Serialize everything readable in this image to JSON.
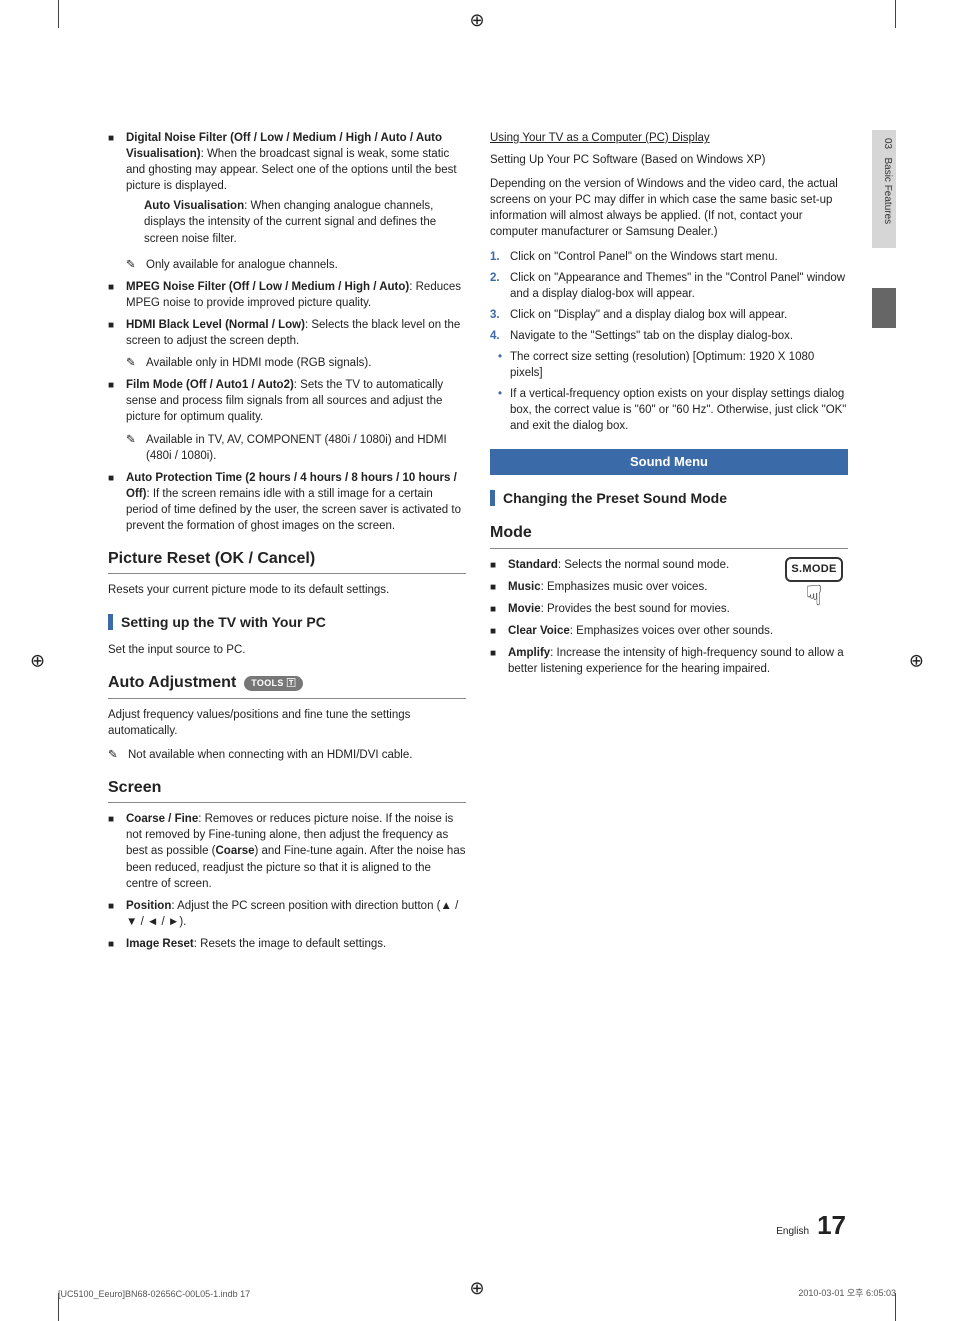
{
  "marks": {
    "reg": "⊕"
  },
  "sideTab": {
    "chapter": "03",
    "title": "Basic Features"
  },
  "left": {
    "items1": [
      {
        "head": "Digital Noise Filter (Off / Low / Medium / High / Auto / Auto Visualisation)",
        "body": ": When the broadcast signal is weak, some static and ghosting may appear. Select one of the options until the best picture is displayed.",
        "sub": [
          {
            "head": "Auto Visualisation",
            "body": ": When changing analogue channels, displays the intensity of the current signal and defines the screen noise filter."
          }
        ],
        "note": "Only available for analogue channels."
      },
      {
        "head": "MPEG Noise Filter (Off / Low / Medium / High / Auto)",
        "body": ": Reduces MPEG noise to provide improved picture quality."
      },
      {
        "head": "HDMI Black Level (Normal / Low)",
        "body": ": Selects the black level on the screen to adjust the screen depth.",
        "note": "Available only in HDMI mode (RGB signals)."
      },
      {
        "head": "Film Mode (Off / Auto1 / Auto2)",
        "body": ": Sets the TV to automatically sense and process film signals from all sources and adjust the picture for optimum quality.",
        "note": "Available in TV, AV, COMPONENT (480i / 1080i) and HDMI (480i / 1080i)."
      },
      {
        "head": "Auto Protection Time (2 hours / 4 hours / 8 hours / 10 hours / Off)",
        "body": ":  If the screen remains idle with a still image for a certain period of time defined by the user, the screen saver is activated to prevent the formation of ghost images on the screen."
      }
    ],
    "h2PictureReset": "Picture Reset (OK / Cancel)",
    "pictureResetBody": "Resets your current picture mode to its default settings.",
    "h3SetupPC": "Setting up the TV with Your PC",
    "setupPCBody": "Set the input source to PC.",
    "h2AutoAdj": "Auto Adjustment",
    "toolsLabel": "TOOLS",
    "toolsIcon": "🅃",
    "autoAdjBody": "Adjust frequency values/positions and fine tune the settings automatically.",
    "autoAdjNote": "Not available when connecting with an HDMI/DVI cable.",
    "h2Screen": "Screen",
    "screenItems": [
      {
        "head": "Coarse / Fine",
        "body": ": Removes or reduces picture noise. If the noise is not removed by Fine-tuning alone, then adjust the frequency as best as possible (",
        "bold": "Coarse",
        "body2": ") and Fine-tune again. After the noise has been reduced, readjust the picture so that it is aligned to the centre of screen."
      },
      {
        "head": "Position",
        "body": ": Adjust the PC screen position with direction button (▲ / ▼ / ◄ / ►)."
      },
      {
        "head": "Image Reset",
        "body": ": Resets the image to default settings."
      }
    ]
  },
  "right": {
    "pcHead": "Using Your TV as a Computer (PC) Display",
    "pcIntro1": "Setting Up Your PC Software (Based on Windows XP)",
    "pcIntro2": "Depending on the version of Windows and the video card, the actual screens on your PC may differ in which case the same basic set-up information will almost always be applied. (If not, contact your computer manufacturer or Samsung Dealer.)",
    "steps": [
      "Click on \"Control Panel\" on the Windows start menu.",
      "Click on \"Appearance and Themes\" in the \"Control Panel\" window and a display dialog-box will appear.",
      "Click on \"Display\" and a display dialog box will appear.",
      "Navigate to the \"Settings\" tab on the display dialog-box."
    ],
    "dots": [
      "The correct size setting (resolution) [Optimum: 1920 X 1080 pixels]",
      "If a vertical-frequency option exists on your display settings dialog box, the correct value is \"60\" or \"60 Hz\". Otherwise, just click \"OK\" and exit the dialog box."
    ],
    "soundMenu": "Sound Menu",
    "changingPreset": "Changing the Preset Sound Mode",
    "h2Mode": "Mode",
    "smode": "S.MODE",
    "modeItems": [
      {
        "head": "Standard",
        "body": ": Selects the normal sound mode."
      },
      {
        "head": "Music",
        "body": ": Emphasizes music over voices."
      },
      {
        "head": "Movie",
        "body": ": Provides the best sound for movies."
      },
      {
        "head": "Clear Voice",
        "body": ": Emphasizes voices over other sounds."
      },
      {
        "head": "Amplify",
        "body": ": Increase the intensity of high-frequency sound to allow a better listening experience for the hearing impaired."
      }
    ]
  },
  "footer": {
    "lang": "English",
    "page": "17"
  },
  "printFooter": {
    "left": "[UC5100_Eeuro]BN68-02656C-00L05-1.indb   17",
    "right": "2010-03-01   오후 6:05:03"
  }
}
